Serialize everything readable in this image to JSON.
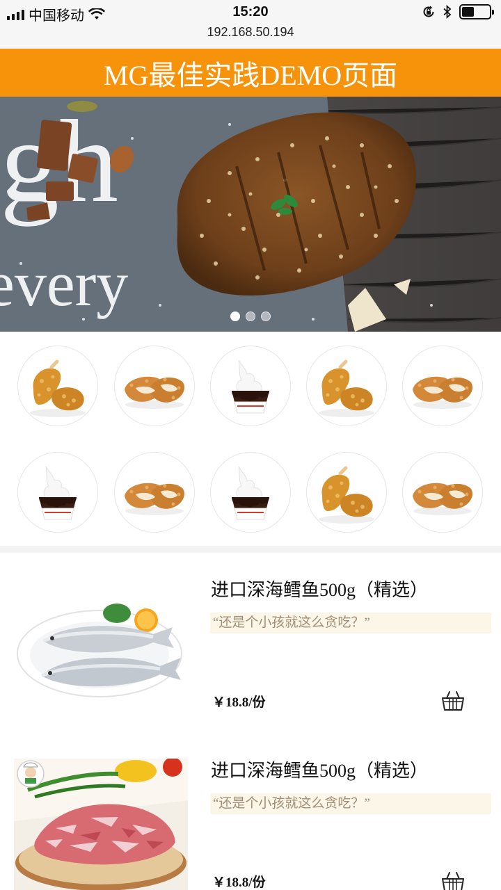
{
  "status_bar": {
    "carrier": "中国移动",
    "time": "15:20",
    "url": "192.168.50.194",
    "battery_level": 0.45
  },
  "header": {
    "title": "MG最佳实践DEMO页面"
  },
  "banner": {
    "slide_count": 3,
    "active_slide": 1,
    "backdrop_text": [
      "gh",
      "every"
    ]
  },
  "categories": {
    "items": [
      {
        "icon": "fried-chicken-icon"
      },
      {
        "icon": "chicken-cutlet-icon"
      },
      {
        "icon": "ice-cream-icon"
      },
      {
        "icon": "fried-chicken-icon"
      },
      {
        "icon": "chicken-cutlet-icon"
      },
      {
        "icon": "ice-cream-icon"
      },
      {
        "icon": "chicken-cutlet-icon"
      },
      {
        "icon": "ice-cream-icon"
      },
      {
        "icon": "fried-chicken-icon"
      },
      {
        "icon": "chicken-cutlet-icon"
      }
    ]
  },
  "products": [
    {
      "title": "进口深海鳕鱼500g（精选）",
      "slogan": "“还是个小孩就这么贪吃？”",
      "price": "￥18.8/份",
      "image": "fish-plate-image",
      "cart_icon": "basket-icon"
    },
    {
      "title": "进口深海鳕鱼500g（精选）",
      "slogan": "“还是个小孩就这么贪吃？”",
      "price": "￥18.8/份",
      "image": "sliced-meat-image",
      "cart_icon": "basket-icon"
    }
  ],
  "colors": {
    "header_bg": "#f7920b",
    "slogan_bg": "#fbf6e8",
    "slogan_text": "#a08d73"
  }
}
